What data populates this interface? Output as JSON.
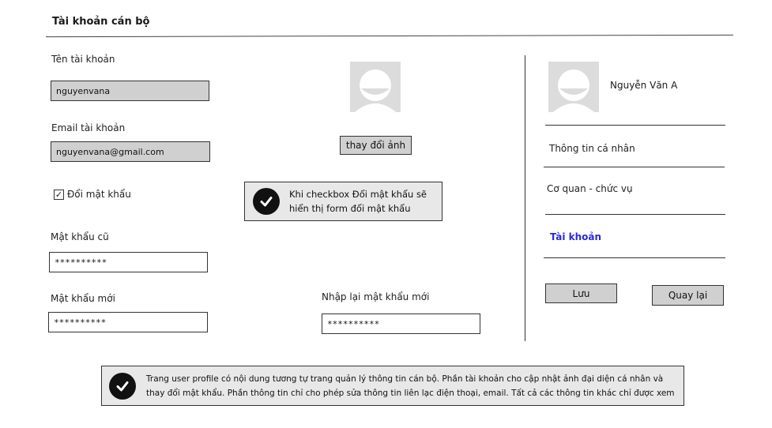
{
  "header": {
    "title": "Tài khoản cán bộ"
  },
  "form": {
    "username_label": "Tên tài khoản",
    "username_value": "nguyenvana",
    "email_label": "Email tài khoản",
    "email_value": "nguyenvana@gmail.com",
    "change_password_checkbox": {
      "label": "Đổi mật khẩu",
      "checked": true,
      "mark": "✓"
    },
    "old_password_label": "Mật khẩu cũ",
    "old_password_value": "**********",
    "new_password_label": "Mật khẩu mới",
    "new_password_value": "**********",
    "confirm_password_label": "Nhập lại mật khẩu mới",
    "confirm_password_value": "**********"
  },
  "avatar_section": {
    "change_photo_label": "thay đổi ảnh"
  },
  "notes": {
    "checkbox_note": "Khi checkbox Đổi mật khẩu sẽ hiển thị form đổi mật khẩu",
    "page_note": "Trang user profile có nội dung tương tự trang quản lý thông tin cán bộ. Phần tài khoản cho cập nhật ảnh đại diện cá nhân và thay đổi mật khẩu. Phần thông tin chỉ cho phép sửa thông tin liên lạc điện thoại, email. Tất cả các thông tin khác chỉ được xem"
  },
  "sidebar": {
    "user_name": "Nguyễn Văn A",
    "items": [
      {
        "label": "Thông tin cá nhân",
        "active": false
      },
      {
        "label": "Cơ quan - chức vụ",
        "active": false
      },
      {
        "label": "Tài khoản",
        "active": true
      }
    ],
    "save_label": "Lưu",
    "back_label": "Quay lại"
  },
  "colors": {
    "active_menu": "#2a2ad6",
    "field_grey": "#d0d0d0",
    "note_bg": "#e8e8e8"
  }
}
